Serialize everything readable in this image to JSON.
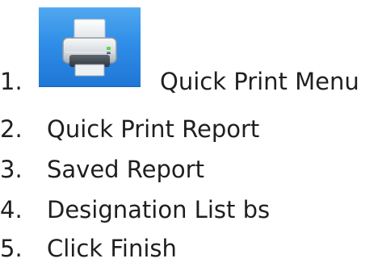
{
  "steps": [
    {
      "number": "1.",
      "label": "Quick Print Menu",
      "icon": "printer-icon"
    },
    {
      "number": "2.",
      "label": "Quick Print Report"
    },
    {
      "number": "3.",
      "label": "Saved Report"
    },
    {
      "number": "4.",
      "label": "Designation List bs"
    },
    {
      "number": "5.",
      "label": "Click Finish"
    }
  ],
  "colors": {
    "button_top": "#4fa7ef",
    "button_bottom": "#1f76d6",
    "text": "#1f1f1f"
  }
}
